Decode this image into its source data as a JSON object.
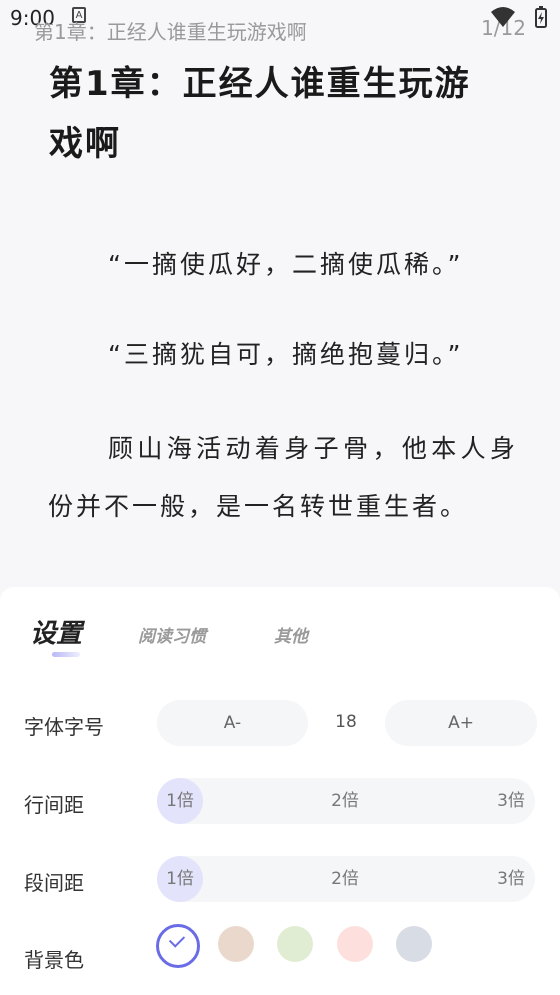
{
  "status_bar": {
    "time": "9:00",
    "notification_glyph": "A",
    "icons": [
      "wifi-icon",
      "battery-icon"
    ]
  },
  "reader_header": {
    "chapter": "第1章：正经人谁重生玩游戏啊",
    "progress": "1/12"
  },
  "content": {
    "title_line1": "第1章：正经人谁重生玩游",
    "title_line2": "戏啊",
    "paragraphs": [
      "“一摘使瓜好，二摘使瓜稀。”",
      "“三摘犹自可，摘绝抱蔓归。”",
      "顾山海活动着身子骨，他本人身份并不一般，是一名转世重生者。"
    ]
  },
  "settings": {
    "tabs": [
      "设置",
      "阅读习惯",
      "其他"
    ],
    "font_size": {
      "label": "字体字号",
      "decrease": "A-",
      "value": "18",
      "increase": "A+"
    },
    "line_spacing": {
      "label": "行间距",
      "options": [
        "1倍",
        "2倍",
        "3倍"
      ],
      "selected": "1倍"
    },
    "paragraph_spacing": {
      "label": "段间距",
      "options": [
        "1倍",
        "2倍",
        "3倍"
      ],
      "selected": "1倍"
    },
    "background": {
      "label": "背景色",
      "colors": [
        "#ffffff",
        "#ead8cc",
        "#e1edd2",
        "#fde0dd",
        "#d8dce4"
      ],
      "selected_index": 0,
      "accent": "#6a6ce6"
    }
  }
}
